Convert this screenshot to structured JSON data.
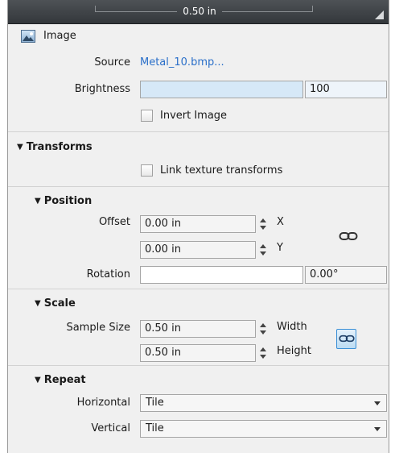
{
  "ruler": {
    "value": "0.50 in"
  },
  "image": {
    "title": "Image",
    "source_label": "Source",
    "source_value": "Metal_10.bmp...",
    "brightness_label": "Brightness",
    "brightness_value": "100",
    "brightness_level": 100,
    "invert_label": "Invert Image",
    "invert_checked": false
  },
  "transforms": {
    "title": "Transforms",
    "link_label": "Link texture transforms",
    "link_checked": false,
    "position": {
      "title": "Position",
      "offset_label": "Offset",
      "offset_x": "0.00 in",
      "x_axis": "X",
      "offset_y": "0.00 in",
      "y_axis": "Y",
      "rotation_label": "Rotation",
      "rotation_value": "0.00°"
    },
    "scale": {
      "title": "Scale",
      "sample_size_label": "Sample Size",
      "width_value": "0.50 in",
      "width_label": "Width",
      "height_value": "0.50 in",
      "height_label": "Height",
      "linked": true
    },
    "repeat": {
      "title": "Repeat",
      "horizontal_label": "Horizontal",
      "horizontal_value": "Tile",
      "vertical_label": "Vertical",
      "vertical_value": "Tile"
    }
  },
  "colors": {
    "accent": "#3b8fd6",
    "link": "#2a6fc9",
    "topbar": "#3f4347"
  }
}
